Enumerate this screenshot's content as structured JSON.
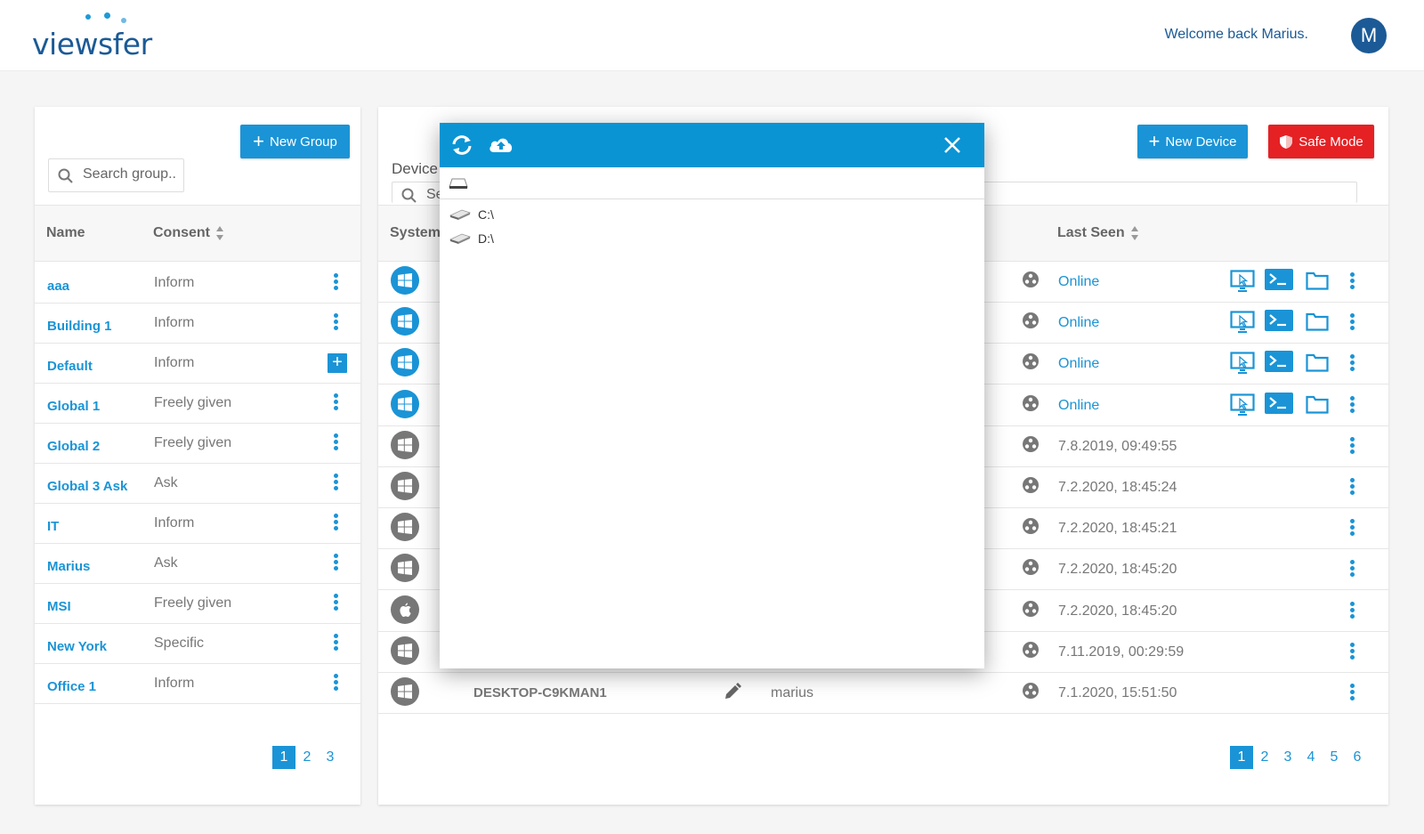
{
  "header": {
    "logo_text": "viewsfer",
    "welcome": "Welcome back Marius.",
    "avatar_initial": "M"
  },
  "groups_panel": {
    "new_group_label": "New Group",
    "search_placeholder": "Search group..",
    "columns": {
      "name": "Name",
      "consent": "Consent"
    },
    "rows": [
      {
        "name": "aaa",
        "consent": "Inform",
        "action": "menu"
      },
      {
        "name": "Building 1",
        "consent": "Inform",
        "action": "menu"
      },
      {
        "name": "Default",
        "consent": "Inform",
        "action": "add"
      },
      {
        "name": "Global 1",
        "consent": "Freely given",
        "action": "menu"
      },
      {
        "name": "Global 2",
        "consent": "Freely given",
        "action": "menu"
      },
      {
        "name": "Global 3 Ask",
        "consent": "Ask",
        "action": "menu"
      },
      {
        "name": "IT",
        "consent": "Inform",
        "action": "menu"
      },
      {
        "name": "Marius",
        "consent": "Ask",
        "action": "menu"
      },
      {
        "name": "MSI",
        "consent": "Freely given",
        "action": "menu"
      },
      {
        "name": "New York",
        "consent": "Specific",
        "action": "menu"
      },
      {
        "name": "Office 1",
        "consent": "Inform",
        "action": "menu"
      }
    ],
    "pages": [
      "1",
      "2",
      "3"
    ],
    "active_page": "1"
  },
  "devices_panel": {
    "new_device_label": "New Device",
    "safe_mode_label": "Safe Mode",
    "device_label": "Device",
    "search_placeholder": "Se",
    "columns": {
      "system": "System",
      "last_seen": "Last Seen"
    },
    "rows": [
      {
        "os": "windows",
        "os_color": "#1a94d6",
        "status": "Online",
        "online": true
      },
      {
        "os": "windows",
        "os_color": "#1a94d6",
        "status": "Online",
        "online": true
      },
      {
        "os": "windows",
        "os_color": "#1a94d6",
        "status": "Online",
        "online": true
      },
      {
        "os": "windows",
        "os_color": "#1a94d6",
        "status": "Online",
        "online": true
      },
      {
        "os": "windows",
        "os_color": "#777777",
        "status": "7.8.2019, 09:49:55",
        "online": false
      },
      {
        "os": "windows",
        "os_color": "#777777",
        "status": "7.2.2020, 18:45:24",
        "online": false
      },
      {
        "os": "windows",
        "os_color": "#777777",
        "status": "7.2.2020, 18:45:21",
        "online": false
      },
      {
        "os": "windows",
        "os_color": "#777777",
        "status": "7.2.2020, 18:45:20",
        "online": false
      },
      {
        "os": "apple",
        "os_color": "#777777",
        "status": "7.2.2020, 18:45:20",
        "online": false
      },
      {
        "os": "windows",
        "os_color": "#777777",
        "status": "7.11.2019, 00:29:59",
        "online": false
      },
      {
        "os": "windows",
        "os_color": "#777777",
        "status": "7.1.2020, 15:51:50",
        "online": false,
        "name": "DESKTOP-C9KMAN1",
        "user": "marius"
      }
    ],
    "pages": [
      "1",
      "2",
      "3",
      "4",
      "5",
      "6"
    ],
    "active_page": "1"
  },
  "file_browser": {
    "drives": [
      "C:\\",
      "D:\\"
    ]
  },
  "colors": {
    "accent": "#1a94d6",
    "brand": "#1b5a96",
    "danger": "#e52124",
    "modal_header": "#0a94d4"
  },
  "icons": [
    "refresh-icon",
    "cloud-upload-icon",
    "close-icon",
    "drive-icon",
    "remote-desktop-icon",
    "terminal-icon",
    "folder-icon",
    "network-icon",
    "windows-icon",
    "apple-icon",
    "pencil-icon",
    "shield-icon",
    "search-icon"
  ]
}
